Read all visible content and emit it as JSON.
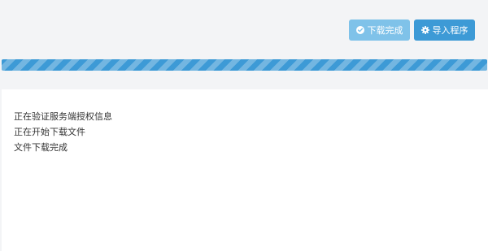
{
  "toolbar": {
    "download_done_label": "下载完成",
    "import_label": "导入程序"
  },
  "progress": {
    "percent": 100
  },
  "log": {
    "lines": [
      "正在验证服务端授权信息",
      "正在开始下载文件",
      "文件下载完成"
    ]
  },
  "colors": {
    "primary": "#3d9ad6",
    "primary_light": "#7fc2e9",
    "background": "#f3f4f6",
    "panel": "#ffffff",
    "text": "#333333"
  }
}
